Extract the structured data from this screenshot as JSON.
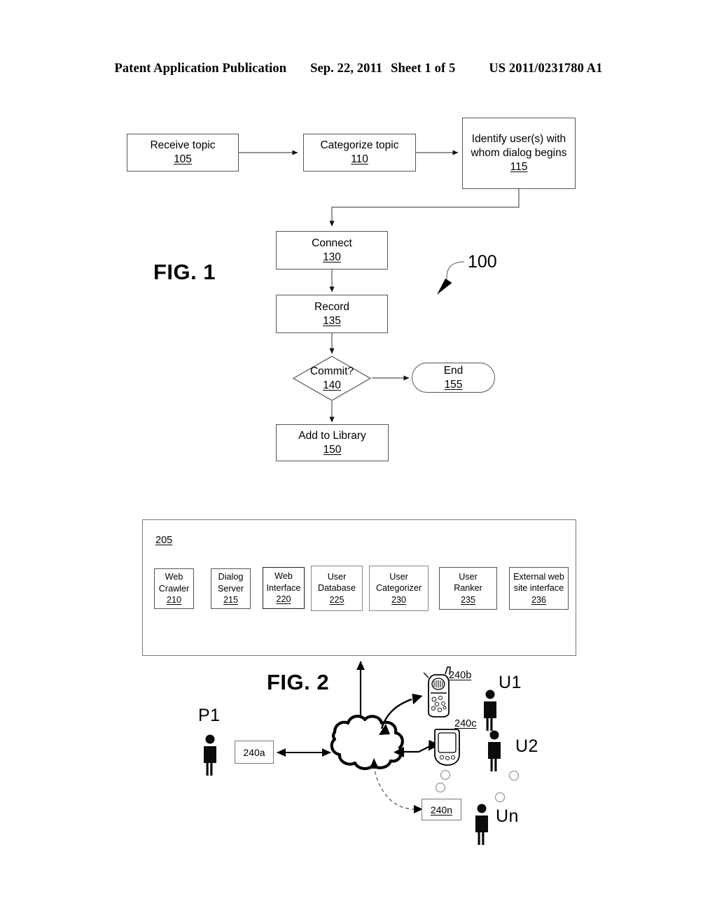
{
  "header": {
    "publication": "Patent Application Publication",
    "date": "Sep. 22, 2011",
    "sheet": "Sheet 1 of 5",
    "number": "US 2011/0231780 A1"
  },
  "figure1": {
    "caption": "FIG. 1",
    "diagram_ref": "100",
    "nodes": [
      {
        "id": "receive-topic",
        "label": "Receive topic",
        "ref": "105",
        "shape": "rect"
      },
      {
        "id": "categorize-topic",
        "label": "Categorize topic",
        "ref": "110",
        "shape": "rect"
      },
      {
        "id": "identify-users",
        "label": "Identify user(s) with whom dialog begins",
        "ref": "115",
        "shape": "rect"
      },
      {
        "id": "connect",
        "label": "Connect",
        "ref": "130",
        "shape": "rect"
      },
      {
        "id": "record",
        "label": "Record",
        "ref": "135",
        "shape": "rect"
      },
      {
        "id": "commit",
        "label": "Commit?",
        "ref": "140",
        "shape": "diamond"
      },
      {
        "id": "end",
        "label": "End",
        "ref": "155",
        "shape": "rounded"
      },
      {
        "id": "add-to-library",
        "label": "Add to Library",
        "ref": "150",
        "shape": "rect"
      }
    ]
  },
  "figure2": {
    "caption": "FIG. 2",
    "system_ref": "205",
    "modules": [
      {
        "id": "web-crawler",
        "line1": "Web",
        "line2": "Crawler",
        "ref": "210"
      },
      {
        "id": "dialog-server",
        "line1": "Dialog",
        "line2": "Server",
        "ref": "215"
      },
      {
        "id": "web-interface",
        "line1": "Web",
        "line2": "Interface",
        "ref": "220"
      },
      {
        "id": "user-database",
        "line1": "User",
        "line2": "Database",
        "ref": "225"
      },
      {
        "id": "user-categorizer",
        "line1": "User",
        "line2": "Categorizer",
        "ref": "230"
      },
      {
        "id": "user-ranker",
        "line1": "User",
        "line2": "Ranker",
        "ref": "235"
      },
      {
        "id": "external-site-interface",
        "line1": "External web",
        "line2": "site interface",
        "ref": "236"
      }
    ],
    "network": {
      "terminal_a": "240a",
      "device_b": "240b",
      "device_c": "240c",
      "terminal_n": "240n",
      "cloud_name": "network-cloud"
    },
    "actors": [
      {
        "id": "p1",
        "label": "P1"
      },
      {
        "id": "u1",
        "label": "U1"
      },
      {
        "id": "u2",
        "label": "U2"
      },
      {
        "id": "un",
        "label": "Un"
      }
    ]
  },
  "icons": {
    "person": "person-icon",
    "cellphone": "cellphone-icon",
    "pda": "pda-icon",
    "cloud": "cloud-icon",
    "ellipsis_dot": "ellipsis-dot-icon"
  },
  "colors": {
    "ink": "#000000",
    "line": "#555555",
    "light_line": "#777777",
    "paper": "#ffffff"
  }
}
